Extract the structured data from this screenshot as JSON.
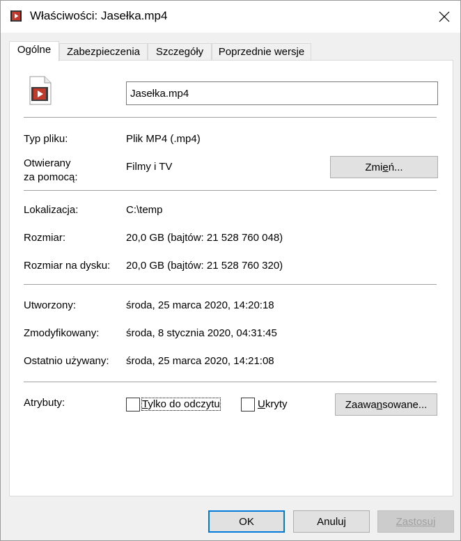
{
  "window": {
    "title": "Właściwości: Jasełka.mp4",
    "accent_color": "#0078d7"
  },
  "tabs": [
    {
      "label": "Ogólne",
      "active": true
    },
    {
      "label": "Zabezpieczenia",
      "active": false
    },
    {
      "label": "Szczegóły",
      "active": false
    },
    {
      "label": "Poprzednie wersje",
      "active": false
    }
  ],
  "general": {
    "file_name": "Jasełka.mp4",
    "file_icon": "video-file-icon",
    "type_label": "Typ pliku:",
    "type_value": "Plik MP4 (.mp4)",
    "opens_with_label_1": "Otwierany",
    "opens_with_label_2": "za pomocą:",
    "opens_with_value": "Filmy i TV",
    "change_button": {
      "pre": "Zmi",
      "accel": "e",
      "post": "ń..."
    },
    "location_label": "Lokalizacja:",
    "location_value": "C:\\temp",
    "size_label": "Rozmiar:",
    "size_value": "20,0 GB (bajtów: 21 528 760 048)",
    "size_on_disk_label": "Rozmiar na dysku:",
    "size_on_disk_value": "20,0 GB (bajtów: 21 528 760 320)",
    "created_label": "Utworzony:",
    "created_value": "środa, 25 marca 2020, 14:20:18",
    "modified_label": "Zmodyfikowany:",
    "modified_value": "środa, 8 stycznia 2020, 04:31:45",
    "accessed_label": "Ostatnio używany:",
    "accessed_value": "środa, 25 marca 2020, 14:21:08",
    "attributes_label": "Atrybuty:",
    "readonly": {
      "pre": "",
      "accel": "T",
      "post": "ylko do odczytu",
      "checked": false
    },
    "hidden": {
      "pre": "",
      "accel": "U",
      "post": "kryty",
      "checked": false
    },
    "advanced_button": {
      "pre": "Zaawa",
      "accel": "n",
      "post": "sowane..."
    }
  },
  "footer": {
    "ok_label": "OK",
    "cancel_label": "Anuluj",
    "apply_label": "Zastosuj",
    "apply_enabled": false
  }
}
